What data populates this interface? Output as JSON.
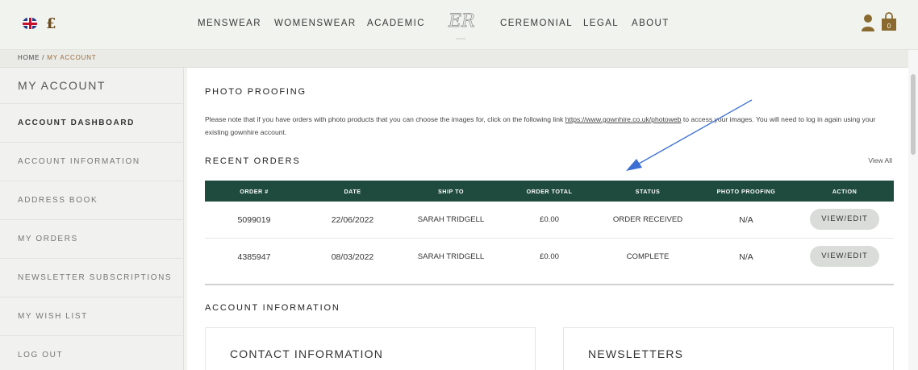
{
  "header": {
    "currency_symbol": "£",
    "nav": [
      "MENSWEAR",
      "WOMENSWEAR",
      "ACADEMIC",
      "CEREMONIAL",
      "LEGAL",
      "ABOUT"
    ],
    "logo_text": "ER",
    "bag_count": "0",
    "colors": {
      "brand_green": "#1f4a3e",
      "gold": "#8a6a2e"
    }
  },
  "breadcrumb": {
    "home": "HOME",
    "separator": " / ",
    "current": "MY ACCOUNT"
  },
  "sidebar": {
    "title": "MY ACCOUNT",
    "items": [
      {
        "label": "ACCOUNT DASHBOARD",
        "active": true
      },
      {
        "label": "ACCOUNT INFORMATION"
      },
      {
        "label": "ADDRESS BOOK"
      },
      {
        "label": "MY ORDERS"
      },
      {
        "label": "NEWSLETTER SUBSCRIPTIONS"
      },
      {
        "label": "MY WISH LIST"
      },
      {
        "label": "LOG OUT"
      }
    ]
  },
  "main": {
    "photo_proofing_title": "PHOTO PROOFING",
    "note_before_link": "Please note that if you have orders with photo products that you can choose the images for, click on the following link ",
    "note_link": "https://www.gownhire.co.uk/photoweb",
    "note_after_link": " to access your images. You will need to log in again using your existing gownhire account.",
    "recent_orders_title": "RECENT ORDERS",
    "view_all": "View All",
    "table": {
      "headers": [
        "ORDER #",
        "DATE",
        "SHIP TO",
        "ORDER TOTAL",
        "STATUS",
        "PHOTO PROOFING",
        "ACTION"
      ],
      "rows": [
        {
          "order": "5099019",
          "date": "22/06/2022",
          "ship_to": "SARAH TRIDGELL",
          "total": "£0.00",
          "status": "ORDER RECEIVED",
          "proofing": "N/A",
          "action": "VIEW/EDIT"
        },
        {
          "order": "4385947",
          "date": "08/03/2022",
          "ship_to": "SARAH TRIDGELL",
          "total": "£0.00",
          "status": "COMPLETE",
          "proofing": "N/A",
          "action": "VIEW/EDIT"
        }
      ]
    },
    "account_info_title": "ACCOUNT INFORMATION",
    "contact_info_title": "CONTACT INFORMATION",
    "newsletters_title": "NEWSLETTERS"
  },
  "annotation": {
    "arrow_color": "#3b6fd4"
  }
}
